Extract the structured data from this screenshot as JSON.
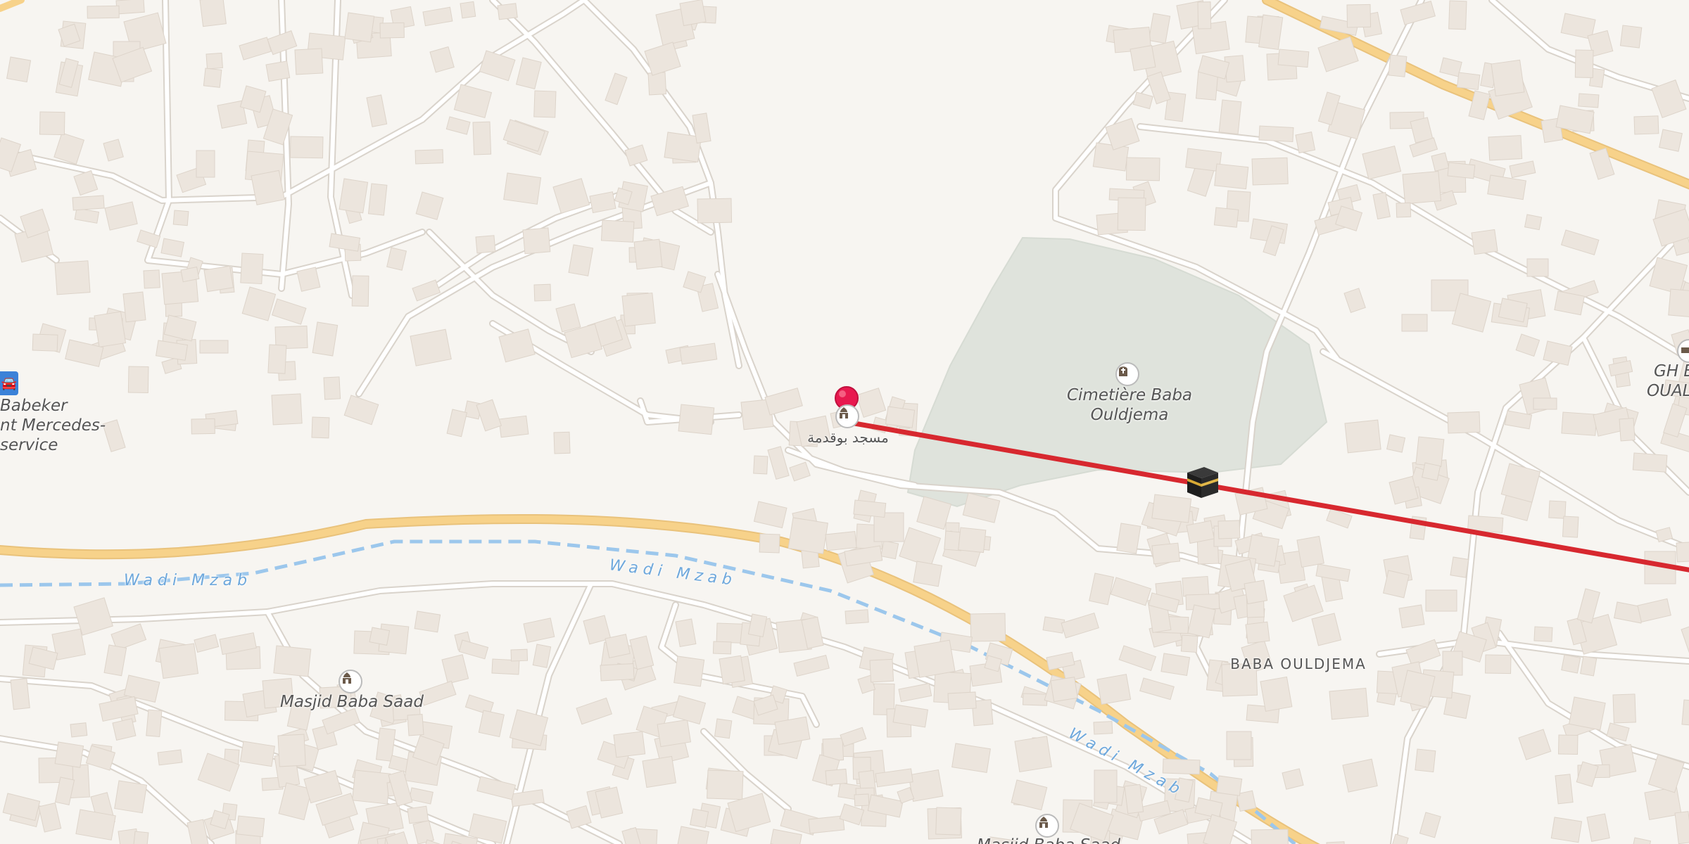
{
  "map": {
    "labels": {
      "mosque_boqudma": "مسجد بوقدمة",
      "cemetery_line1": "Cimetière Baba",
      "cemetery_line2": "Ouldjema",
      "masjid_baba_saad": "Masjid Baba Saad",
      "masjid_baba_saad_bottom": "Masjid Baba Saad",
      "district": "BABA OULDJEMA",
      "right_cut_line1": "GH B",
      "right_cut_line2": "OUALC",
      "left_cut_line1": "Babeker",
      "left_cut_line2": "nt Mercedes-",
      "left_cut_line3": "service"
    },
    "river": {
      "label_left": "Wadi Mzab",
      "label_mid": "Wadi Mzab",
      "label_right": "Wadi Mzab"
    },
    "icons": {
      "location_pin": "location-pin-icon",
      "kaaba": "kaaba-icon",
      "mosque": "mosque-icon",
      "cemetery": "cemetery-icon",
      "car_wash": "car-wash-icon"
    },
    "colors": {
      "background": "#f7f5f1",
      "road": "#ffffff",
      "main_road": "#f7d28a",
      "river": "#9cc7ec",
      "cemetery_area": "#dfe3dc",
      "qibla_line": "#d7282f",
      "pin": "#e8194f",
      "building": "#ece5dd"
    }
  }
}
